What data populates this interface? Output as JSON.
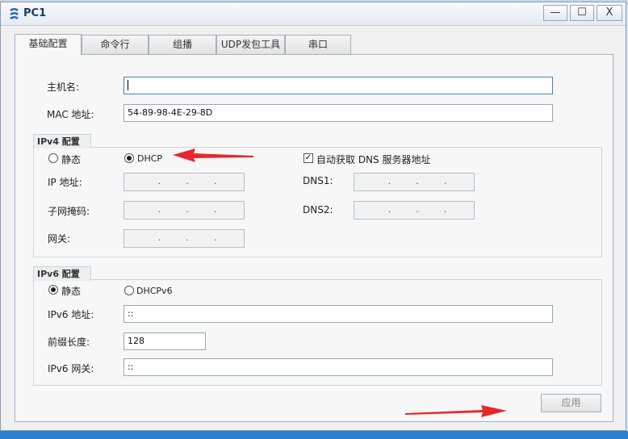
{
  "window": {
    "title": "PC1",
    "minimize": "—",
    "maximize": "☐",
    "close": "X"
  },
  "tabs": [
    {
      "label": "基础配置",
      "active": true
    },
    {
      "label": "命令行"
    },
    {
      "label": "组播"
    },
    {
      "label": "UDP发包工具"
    },
    {
      "label": "串口"
    }
  ],
  "basic": {
    "hostname_label": "主机名:",
    "hostname_value": "",
    "mac_label": "MAC 地址:",
    "mac_value": "54-89-98-4E-29-8D"
  },
  "ipv4": {
    "section_label": "IPv4 配置",
    "static_label": "静态",
    "dhcp_label": "DHCP",
    "selected": "DHCP",
    "auto_dns_label": "自动获取 DNS 服务器地址",
    "auto_dns_checked": true,
    "ip_label": "IP 地址:",
    "mask_label": "子网掩码:",
    "gateway_label": "网关:",
    "dns1_label": "DNS1:",
    "dns2_label": "DNS2:"
  },
  "ipv6": {
    "section_label": "IPv6 配置",
    "static_label": "静态",
    "dhcpv6_label": "DHCPv6",
    "selected": "静态",
    "addr_label": "IPv6 地址:",
    "addr_value": "::",
    "prefix_label": "前缀长度:",
    "prefix_value": "128",
    "gateway_label": "IPv6 网关:",
    "gateway_value": "::"
  },
  "apply_label": "应用",
  "colors": {
    "arrow": "#e8262b",
    "focus": "#3a86c8",
    "title_text": "#1b3a6b"
  }
}
